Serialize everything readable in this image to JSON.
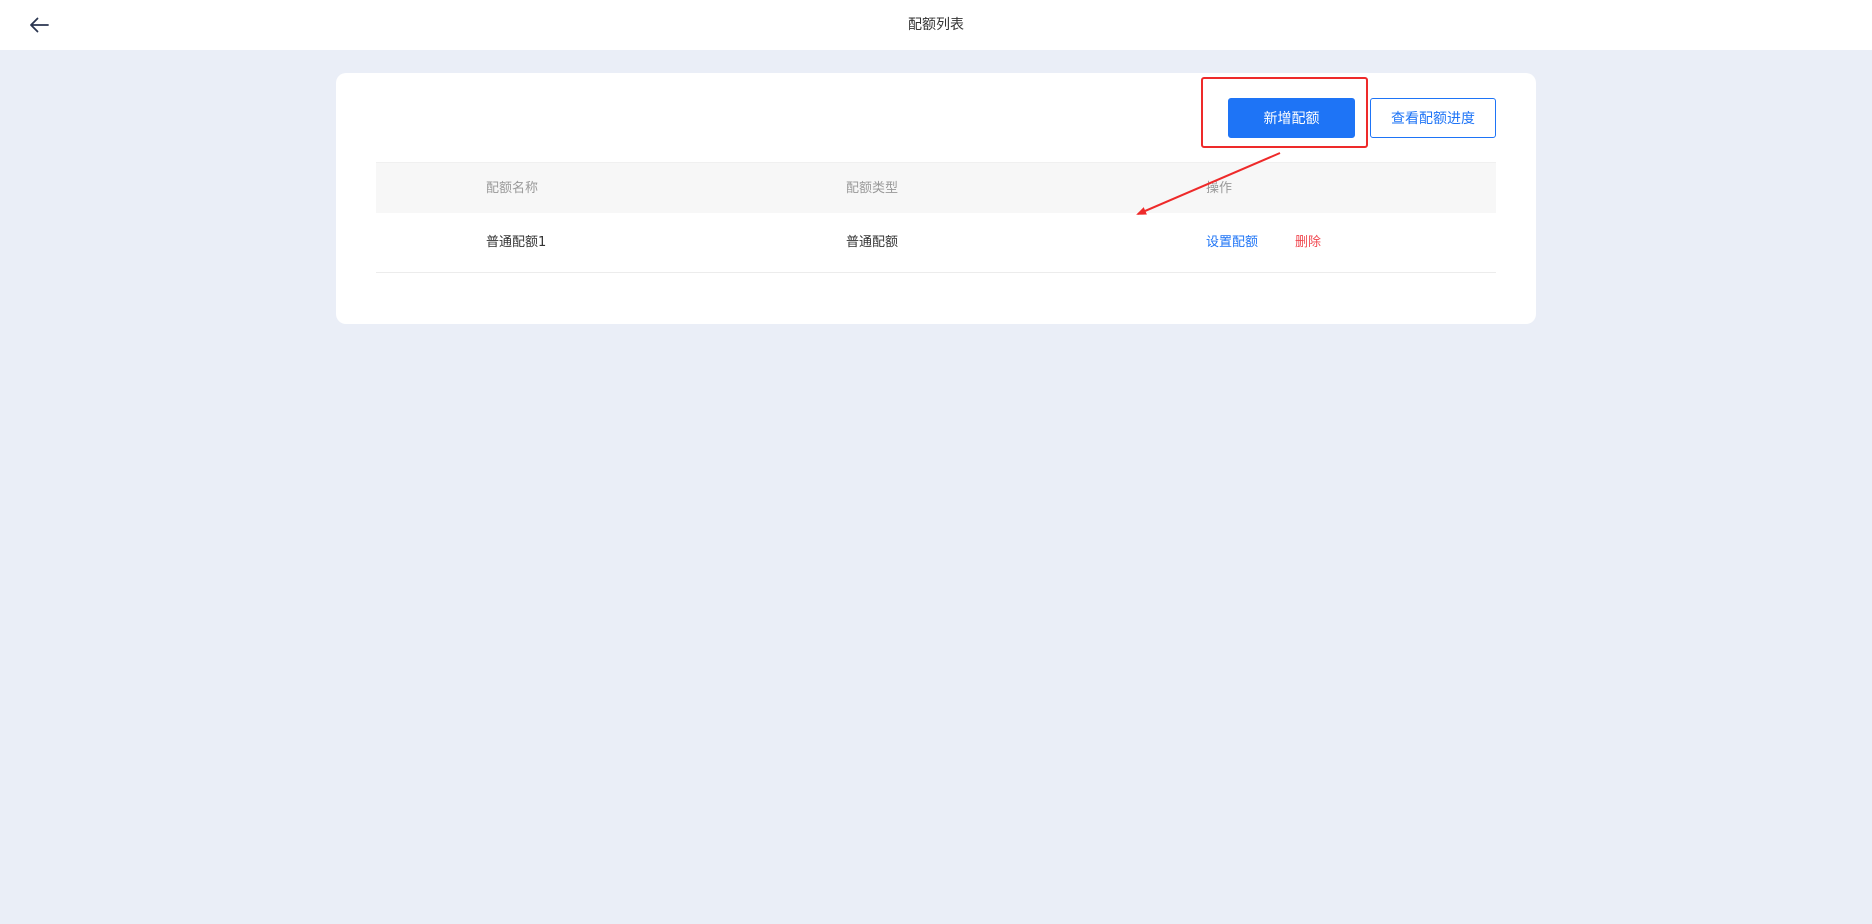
{
  "header": {
    "back_icon": "arrow-left-icon",
    "title": "配额列表"
  },
  "toolbar": {
    "add_label": "新增配额",
    "progress_label": "查看配额进度"
  },
  "table": {
    "columns": [
      "配额名称",
      "配额类型",
      "操作"
    ],
    "rows": [
      {
        "name": "普通配额1",
        "type": "普通配额",
        "actions": {
          "set_label": "设置配额",
          "delete_label": "删除"
        }
      }
    ]
  },
  "colors": {
    "page_background": "#eaeef7",
    "primary": "#1e74f6",
    "danger": "#f0474f",
    "annotation": "#ee2a2a"
  }
}
